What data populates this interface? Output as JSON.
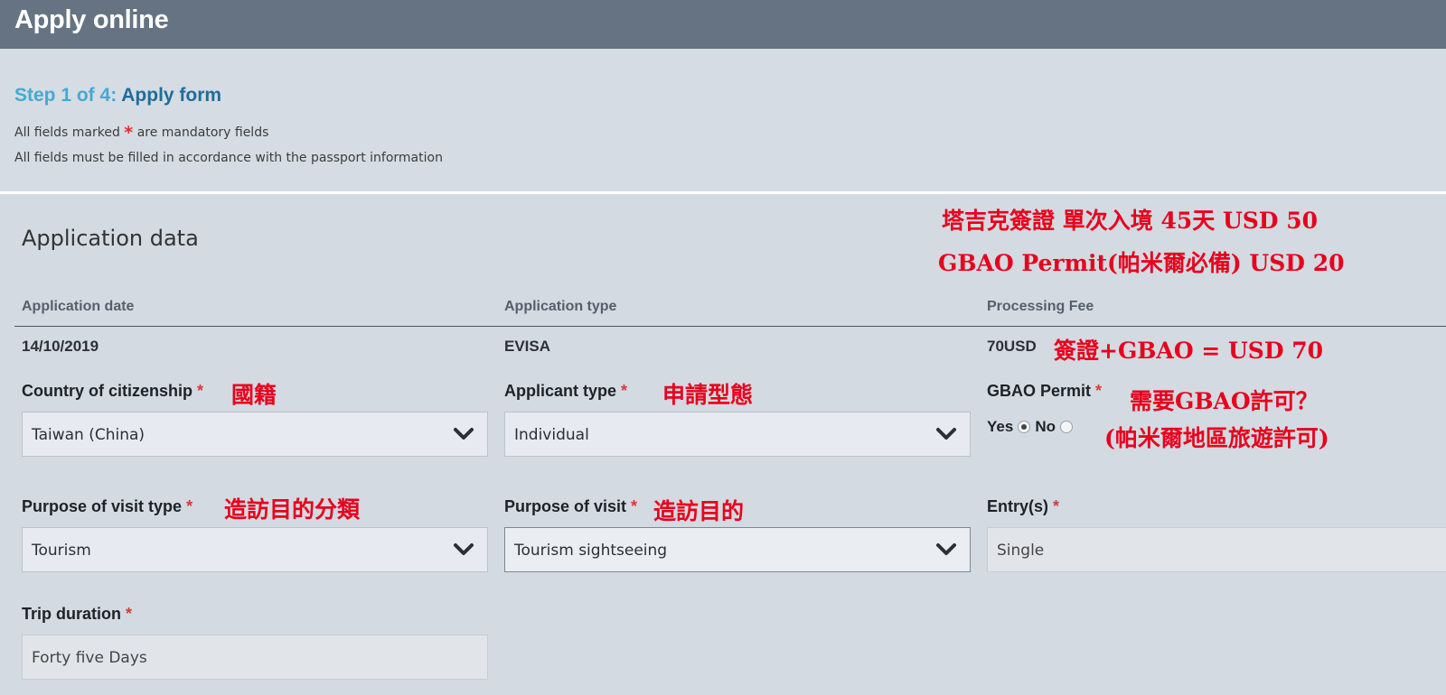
{
  "header": {
    "title": "Apply online"
  },
  "intro": {
    "step_number": "Step 1 of 4:",
    "step_title": "Apply form",
    "mandatory_note_before": "All fields marked",
    "mandatory_star": "*",
    "mandatory_note_after": "are mandatory fields",
    "passport_note": "All fields must be filled in accordance with the passport information"
  },
  "section": {
    "title": "Application data"
  },
  "summary": {
    "application_date_label": "Application date",
    "application_date_value": "14/10/2019",
    "application_type_label": "Application type",
    "application_type_value": "EVISA",
    "processing_fee_label": "Processing Fee",
    "processing_fee_value": "70USD"
  },
  "form": {
    "required_mark": "*",
    "country": {
      "label": "Country of citizenship",
      "value": "Taiwan (China)"
    },
    "applicant_type": {
      "label": "Applicant type",
      "value": "Individual"
    },
    "gbao_permit": {
      "label": "GBAO Permit",
      "yes": "Yes",
      "no": "No",
      "selected": "Yes"
    },
    "purpose_type": {
      "label": "Purpose of visit type",
      "value": "Tourism"
    },
    "purpose": {
      "label": "Purpose of visit",
      "value": "Tourism sightseeing"
    },
    "entries": {
      "label": "Entry(s)",
      "value": "Single"
    },
    "trip_duration": {
      "label": "Trip duration",
      "value": "Forty five Days"
    }
  },
  "annotations": {
    "visa_line_red": "塔吉克簽證 單次入境",
    "visa_days": "45天",
    "visa_usd": "USD",
    "visa_price": "50",
    "gbao_line_red": "GBAO Permit(帕米爾必備) USD",
    "gbao_price": "20",
    "fee_sum": "簽證+GBAO = USD 70",
    "citizenship": "國籍",
    "applicant_type": "申請型態",
    "gbao_need_1": "需要GBAO許可？",
    "gbao_need_2": "(帕米爾地區旅遊許可)",
    "purpose_type": "造訪目的分類",
    "purpose": "造訪目的"
  },
  "colors": {
    "header_bg": "#667382",
    "page_bg": "#d3dae2",
    "step_accent": "#46a9d3",
    "step_title": "#1f6d9a",
    "required": "#d83a34",
    "annotation_red": "#e8001c",
    "annotation_blue": "#0b22d6"
  },
  "icons": {
    "select_arrow": "chevron-down-icon"
  }
}
